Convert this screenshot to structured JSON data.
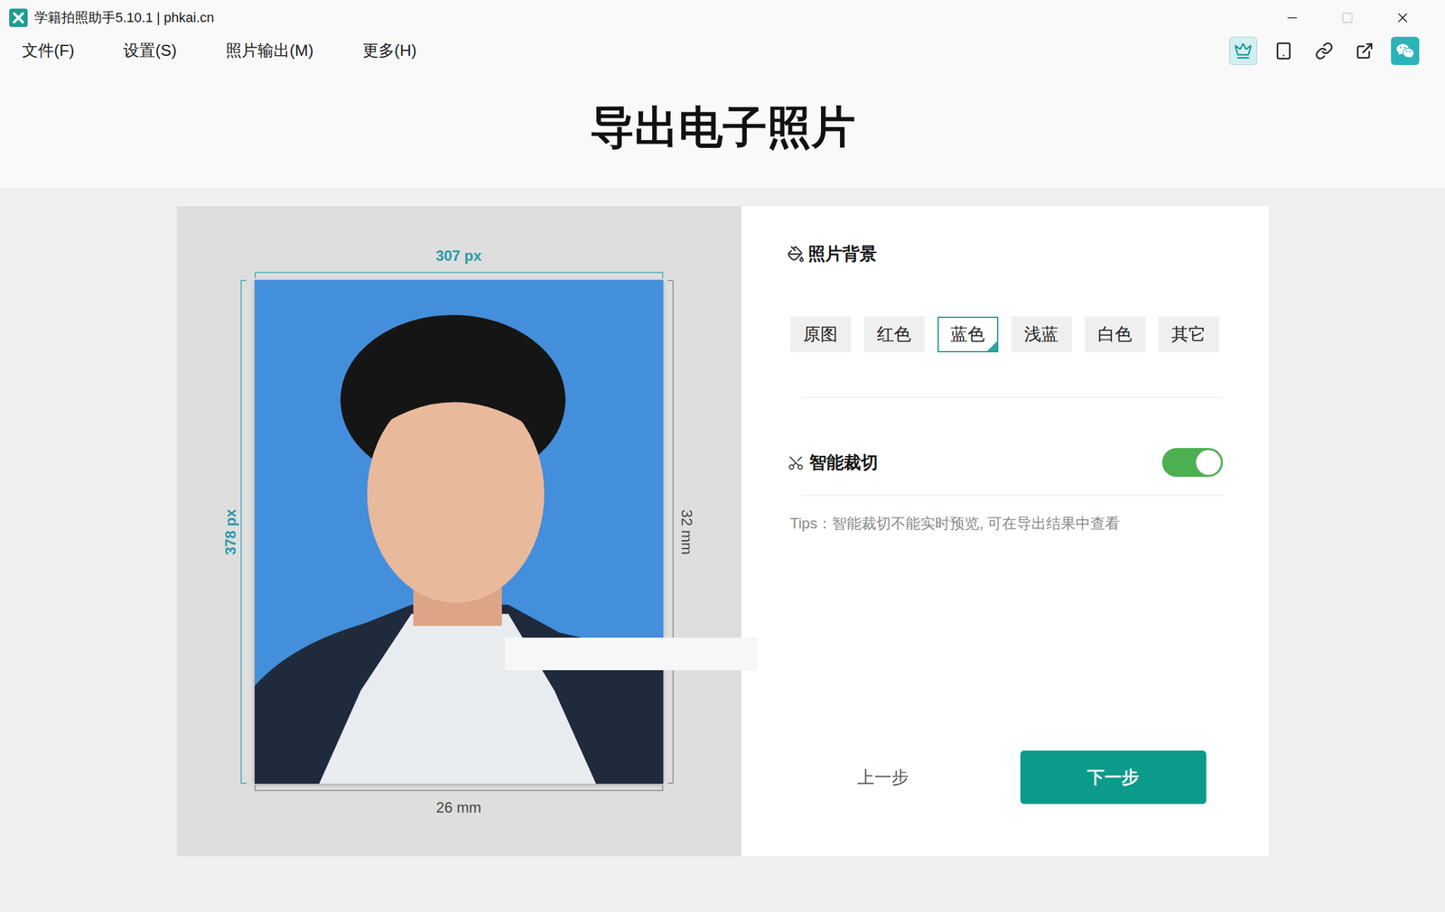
{
  "window": {
    "title": "学籍拍照助手5.10.1 | phkai.cn"
  },
  "menu": [
    "文件(F)",
    "设置(S)",
    "照片输出(M)",
    "更多(H)"
  ],
  "toolbar": [
    {
      "selected": true
    },
    {
      "selected": false
    },
    {
      "selected": false
    },
    {
      "selected": false
    },
    {
      "selected": false
    }
  ],
  "page_title": "导出电子照片",
  "preview": {
    "width_px": "307 px",
    "height_px": "378 px",
    "height_mm": "32 mm",
    "width_mm": "26 mm"
  },
  "background": {
    "title": "照片背景",
    "options": [
      {
        "label": "原图",
        "selected": false
      },
      {
        "label": "红色",
        "selected": false
      },
      {
        "label": "蓝色",
        "selected": true
      },
      {
        "label": "浅蓝",
        "selected": false
      },
      {
        "label": "白色",
        "selected": false
      },
      {
        "label": "其它",
        "selected": false
      }
    ]
  },
  "smart_crop": {
    "label": "智能裁切",
    "on": true,
    "tips": "Tips：智能裁切不能实时预览, 可在导出结果中查看"
  },
  "buttons": {
    "prev": "上一步",
    "next": "下一步"
  }
}
